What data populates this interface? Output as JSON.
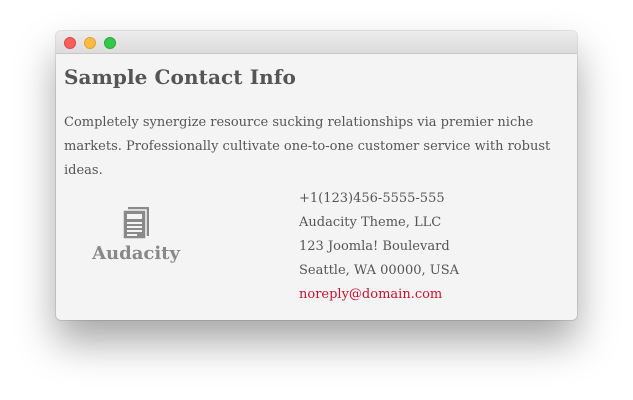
{
  "window": {
    "controls": [
      "close",
      "minimize",
      "zoom"
    ]
  },
  "page": {
    "title": "Sample Contact Info",
    "intro": "Completely synergize resource sucking relationships via premier niche markets. Professionally cultivate one-to-one customer service with robust ideas."
  },
  "logo": {
    "icon": "newspaper-icon",
    "text": "Audacity"
  },
  "contact": {
    "phone": "+1(123)456-5555-555",
    "company": "Audacity Theme, LLC",
    "street": "123 Joomla! Boulevard",
    "city": "Seattle, WA 00000, USA",
    "email": "noreply@domain.com"
  },
  "colors": {
    "link": "#c4122f",
    "text": "#555555",
    "logo": "#888888"
  }
}
